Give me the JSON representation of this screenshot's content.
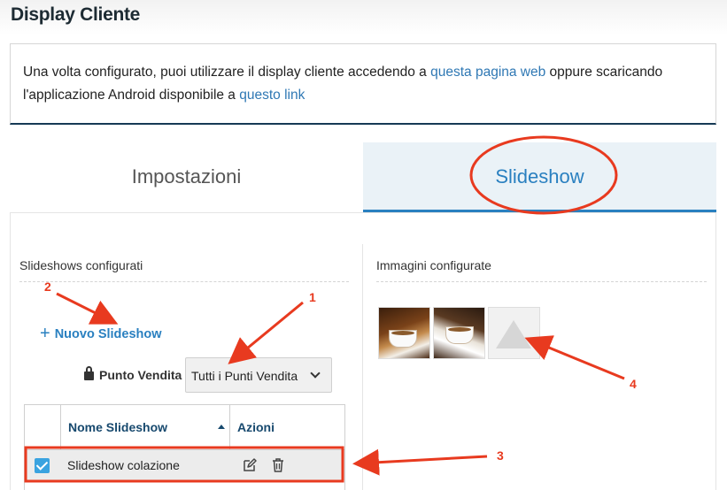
{
  "page": {
    "title": "Display Cliente"
  },
  "info": {
    "text_1": "Una volta configurato, puoi utilizzare il display cliente accedendo a ",
    "link_1": "questa pagina web",
    "text_2": " oppure scaricando l'applicazione Android disponibile a ",
    "link_2": "questo link"
  },
  "tabs": [
    {
      "label": "Impostazioni",
      "active": false
    },
    {
      "label": "Slideshow",
      "active": true
    }
  ],
  "left": {
    "section_title": "Slideshows configurati",
    "new_button": "Nuovo Slideshow",
    "point_of_sale_label": "Punto Vendita",
    "point_of_sale_value": "Tutti i Punti Vendita",
    "table": {
      "columns": [
        "Nome Slideshow",
        "Azioni"
      ],
      "rows": [
        {
          "checked": true,
          "name": "Slideshow colazione"
        }
      ]
    }
  },
  "right": {
    "section_title": "Immagini configurate",
    "images": [
      "coffee-croissant-image",
      "coffee-cup-image",
      "image-placeholder-icon"
    ]
  },
  "annotations": {
    "labels": [
      "1",
      "2",
      "3",
      "4"
    ],
    "color": "#e83a1f"
  },
  "colors": {
    "accent": "#2a80c0",
    "active_tab_bg": "#eaf2f7",
    "header_text": "#17496e",
    "checkbox": "#3aa3e0"
  }
}
